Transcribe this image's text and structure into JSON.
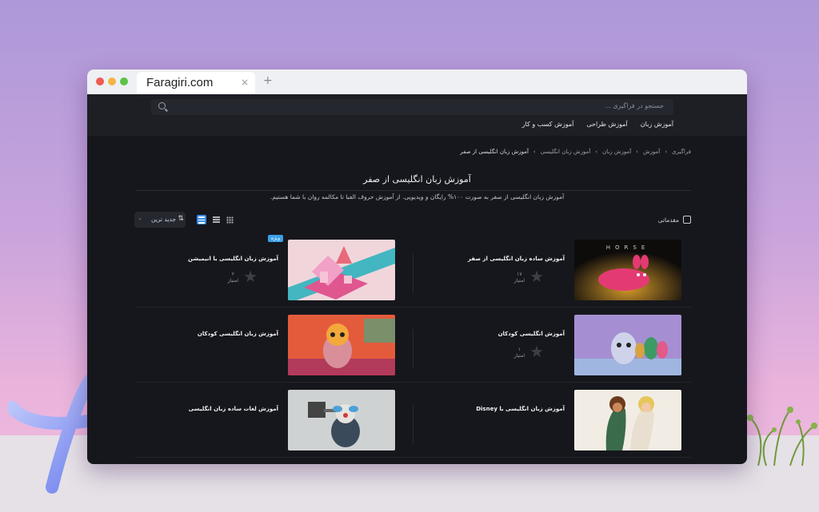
{
  "browser": {
    "tab_title": "Faragiri.com",
    "close_glyph": "×",
    "new_tab_glyph": "+"
  },
  "header": {
    "search_placeholder": "جستجو در فراگیری ...",
    "nav": [
      "آموزش زبان",
      "آموزش طراحی",
      "آموزش کسب و کار"
    ]
  },
  "breadcrumb": [
    "فراگیری",
    "آموزش",
    "آموزش زبان",
    "آموزش زبان انگلیسی",
    "آموزش زبان انگلیسی از صفر"
  ],
  "page": {
    "title": "آموزش زبان انگلیسی از صفر",
    "description": "آموزش زبان انگلیسی از صفر به صورت ۱۰۰% رایگان و ویدیویی. از آموزش حروف الفبا تا مکالمه روان با شما هستیم."
  },
  "filters": {
    "checkbox_label": "مقدماتی",
    "sort_label": "جدید ترین"
  },
  "courses": [
    {
      "title": "آموزش ساده زبان انگلیسی از صفر",
      "rating_count": "۱۷",
      "rating_label": "امتیاز",
      "thumb": "pink-horse"
    },
    {
      "title": "آموزش زبان انگلیسی با انیمیشن",
      "rating_count": "۲",
      "rating_label": "امتیاز",
      "badge": "ویژه",
      "thumb": "isometric-city"
    },
    {
      "title": "آموزش انگلیسی کودکان",
      "rating_count": "۱",
      "rating_label": "امتیاز",
      "thumb": "egg-character"
    },
    {
      "title": "آموزش زبان انگلیسی کودکان",
      "thumb": "owl-character"
    },
    {
      "title": "آموزش زبان انگلیسی با Disney",
      "thumb": "disney-girls"
    },
    {
      "title": "آموزش لغات ساده زبان انگلیسی",
      "thumb": "clown-hammer"
    }
  ]
}
